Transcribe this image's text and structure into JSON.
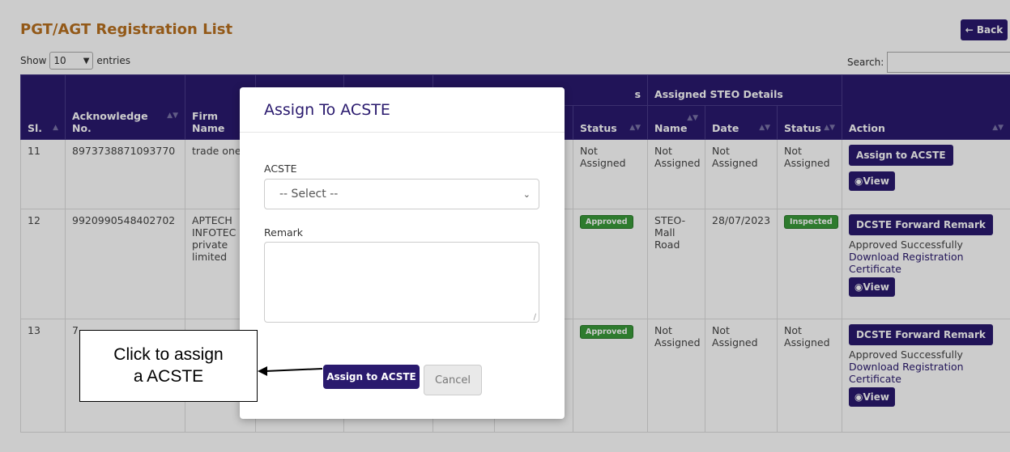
{
  "page": {
    "title": "PGT/AGT Registration List",
    "back_label": "Back",
    "show_label": "Show",
    "entries_value": "10",
    "entries_label": "entries",
    "search_label": "Search:",
    "search_value": ""
  },
  "table": {
    "group_headers": [
      "",
      "Assigned STEO Details"
    ],
    "partial_group_fragment": "s",
    "columns": [
      "Sl.",
      "Acknowledge No.",
      "Firm Name",
      "Status",
      "Name",
      "Date",
      "Status",
      "Action"
    ],
    "rows": [
      {
        "sl": "11",
        "ack": "8973738871093770",
        "firm": "trade one",
        "status": "Not Assigned",
        "steo_name": "Not Assigned",
        "steo_date": "Not Assigned",
        "steo_status": "Not Assigned",
        "action_button": "Assign to ACSTE",
        "action_text": "",
        "action_link": "",
        "view": "View"
      },
      {
        "sl": "12",
        "ack": "9920990548402702",
        "firm": "APTECH INFOTEC private limited",
        "status": "Approved",
        "steo_name": "STEO-Mall Road",
        "steo_date": "28/07/2023",
        "steo_status": "Inspected",
        "action_button": "DCSTE Forward Remark",
        "action_text": "Approved Successfully",
        "action_link": "Download Registration Certificate",
        "view": "View"
      },
      {
        "sl": "13",
        "ack": "7",
        "firm": "",
        "status": "Approved",
        "steo_name": "Not Assigned",
        "steo_date": "Not Assigned",
        "steo_status": "Not Assigned",
        "action_button": "DCSTE Forward Remark",
        "action_text": "Approved Successfully",
        "action_link": "Download Registration Certificate",
        "view": "View"
      }
    ]
  },
  "modal": {
    "title": "Assign To ACSTE",
    "acste_label": "ACSTE",
    "select_value": "-- Select --",
    "remark_label": "Remark",
    "remark_value": "",
    "assign_label": "Assign to ACSTE",
    "cancel_label": "Cancel"
  },
  "callout": {
    "line1": "Click to assign",
    "line2": "a ACSTE"
  },
  "colors": {
    "brand": "#2a1a6e",
    "title": "#b8701f",
    "approved": "#3a9a3a"
  },
  "icons": [
    "back-arrow-icon",
    "chevron-down-icon",
    "sort-icon",
    "eye-icon",
    "resize-handle-icon",
    "arrow-left-icon"
  ]
}
